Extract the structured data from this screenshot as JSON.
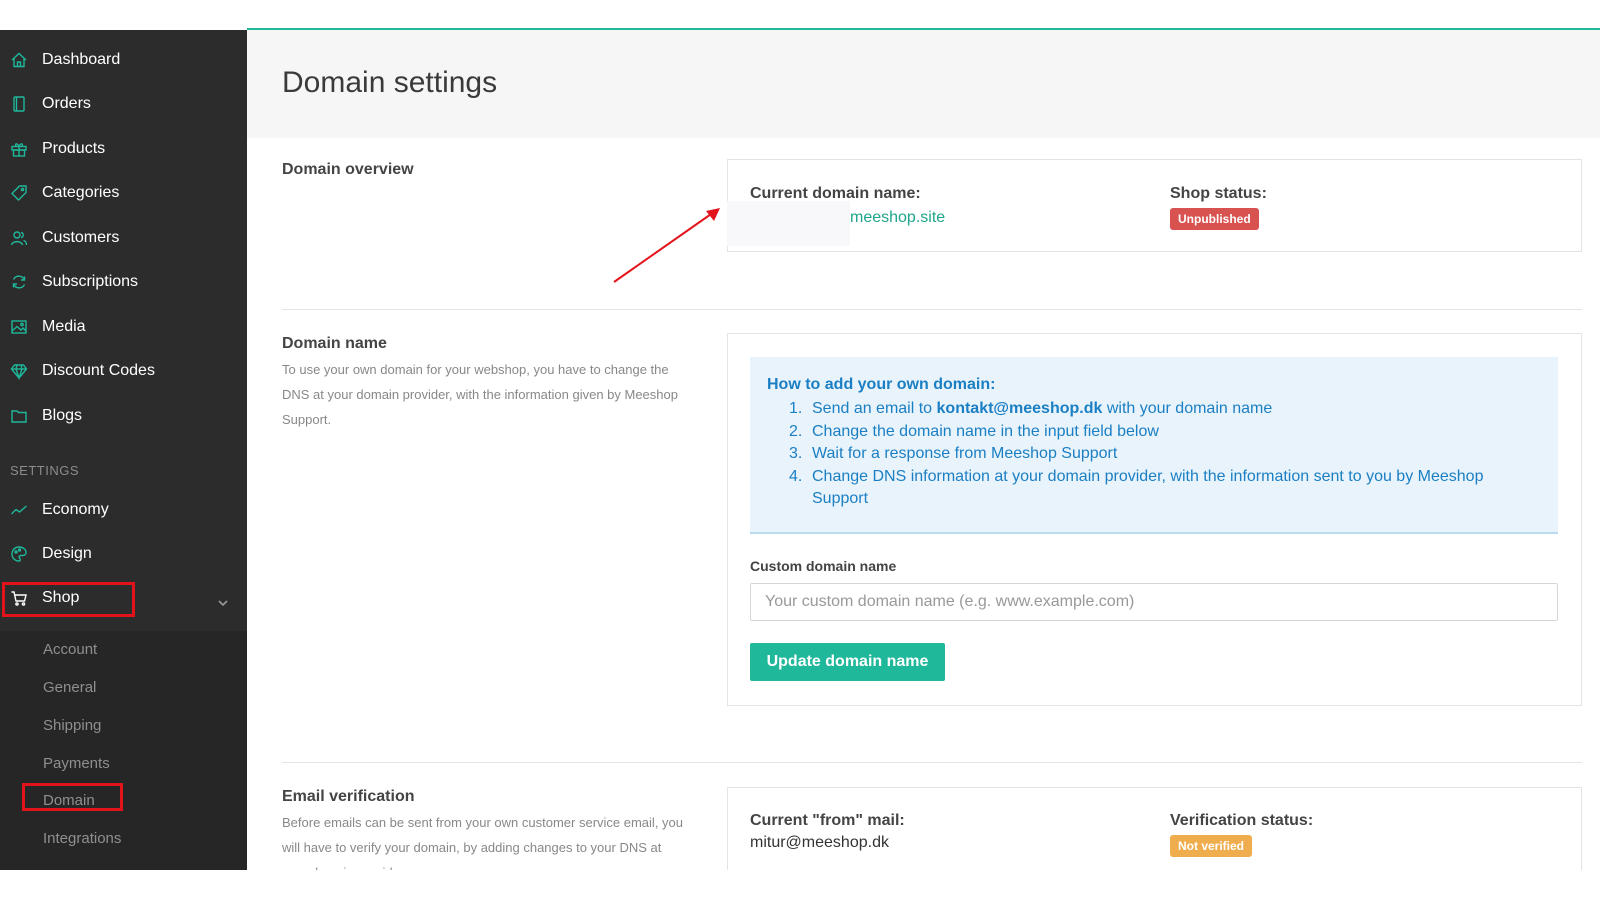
{
  "sidebar": {
    "items": [
      {
        "label": "Dashboard",
        "icon": "home-icon"
      },
      {
        "label": "Orders",
        "icon": "book-icon"
      },
      {
        "label": "Products",
        "icon": "gift-icon"
      },
      {
        "label": "Categories",
        "icon": "tag-icon"
      },
      {
        "label": "Customers",
        "icon": "users-icon"
      },
      {
        "label": "Subscriptions",
        "icon": "refresh-icon"
      },
      {
        "label": "Media",
        "icon": "image-icon"
      },
      {
        "label": "Discount Codes",
        "icon": "diamond-icon"
      },
      {
        "label": "Blogs",
        "icon": "folder-icon"
      }
    ],
    "settings_label": "SETTINGS",
    "settings_items": [
      {
        "label": "Economy",
        "icon": "chart-line-icon"
      },
      {
        "label": "Design",
        "icon": "palette-icon"
      },
      {
        "label": "Shop",
        "icon": "cart-icon"
      }
    ],
    "shop_submenu": [
      "Account",
      "General",
      "Shipping",
      "Payments",
      "Domain",
      "Integrations"
    ]
  },
  "page": {
    "title": "Domain settings"
  },
  "overview": {
    "title": "Domain overview",
    "current_domain_label": "Current domain name:",
    "current_domain_value": "meeshop.site",
    "shop_status_label": "Shop status:",
    "shop_status_value": "Unpublished"
  },
  "domain_name": {
    "title": "Domain name",
    "description": "To use your own domain for your webshop, you have to change the DNS at your domain provider, with the information given by Meeshop Support.",
    "info_title": "How to add your own domain:",
    "steps": [
      {
        "num": "1.",
        "pre": "Send an email to ",
        "bold": "kontakt@meeshop.dk",
        "post": " with your domain name"
      },
      {
        "num": "2.",
        "pre": "Change the domain name in the input field below",
        "bold": "",
        "post": ""
      },
      {
        "num": "3.",
        "pre": "Wait for a response from Meeshop Support",
        "bold": "",
        "post": ""
      },
      {
        "num": "4.",
        "pre": "Change DNS information at your domain provider, with the information sent to you by Meeshop Support",
        "bold": "",
        "post": ""
      }
    ],
    "field_label": "Custom domain name",
    "field_placeholder": "Your custom domain name (e.g. www.example.com)",
    "field_value": "",
    "button_label": "Update domain name"
  },
  "email_verification": {
    "title": "Email verification",
    "description": "Before emails can be sent from your own customer service email, you will have to verify your domain, by adding changes to your DNS at your domain provider.",
    "from_mail_label": "Current \"from\" mail:",
    "from_mail_value": "mitur@meeshop.dk",
    "status_label": "Verification status:",
    "status_value": "Not verified"
  },
  "colors": {
    "accent": "#1fb89a",
    "sidebar_bg": "#2c2c2c",
    "info_text": "#1b7fc4",
    "badge_unpublished": "#d8534f",
    "badge_not_verified": "#f0ad4e",
    "highlight_annotation": "#e3131b"
  }
}
